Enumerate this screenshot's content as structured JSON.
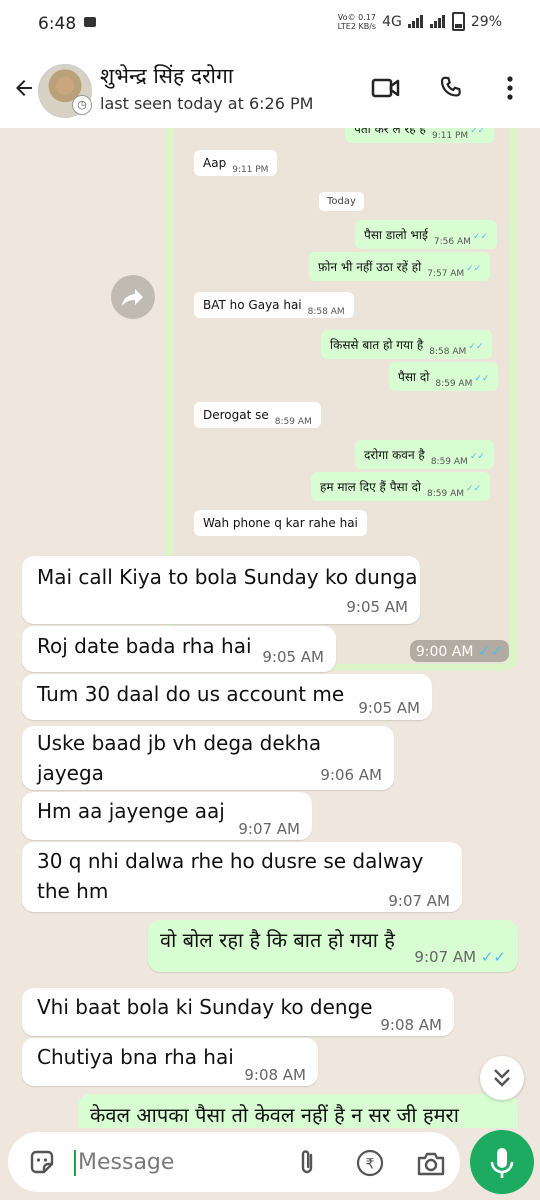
{
  "status_bar": {
    "time": "6:48",
    "network_top": "Vo© 0.17",
    "lte": "LTE2",
    "speed_unit": "KB/s",
    "network": "4G",
    "battery": "29%"
  },
  "header": {
    "contact_name": "शुभेन्द्र सिंह दरोगा",
    "last_seen": "last seen today at 6:26 PM"
  },
  "screenshot": {
    "messages": [
      {
        "dir": "out",
        "text": "पता कर ले रहे हैं",
        "time": "9:11 PM",
        "ticks": "✓✓"
      },
      {
        "dir": "in",
        "text": "Aap",
        "time": "9:11 PM"
      },
      {
        "dir": "out",
        "text": "पैसा डालो भाई",
        "time": "7:56 AM",
        "ticks": "✓✓"
      },
      {
        "dir": "out",
        "text": "फ़ोन भी नहीं उठा रहें हो",
        "time": "7:57 AM",
        "ticks": "✓✓"
      },
      {
        "dir": "in",
        "text": "BAT ho Gaya hai",
        "time": "8:58 AM"
      },
      {
        "dir": "out",
        "text": "किससे बात हो गया है",
        "time": "8:58 AM",
        "ticks": "✓✓"
      },
      {
        "dir": "out",
        "text": "पैसा दो",
        "time": "8:59 AM",
        "ticks": "✓✓"
      },
      {
        "dir": "in",
        "text": "Derogat se",
        "time": "8:59 AM"
      },
      {
        "dir": "out",
        "text": "दरोगा कवन है",
        "time": "8:59 AM",
        "ticks": "✓✓"
      },
      {
        "dir": "out",
        "text": "हम माल दिए हैं पैसा दो",
        "time": "8:59 AM",
        "ticks": "✓✓"
      },
      {
        "dir": "in",
        "text": "Wah phone q kar rahe hai",
        "time": ""
      }
    ],
    "today_label": "Today",
    "time": "9:00 AM",
    "ticks": "✓✓"
  },
  "messages": [
    {
      "dir": "in",
      "text": "Mai call Kiya to bola Sunday ko dunga",
      "time": "9:05 AM"
    },
    {
      "dir": "in",
      "text": "Roj date bada rha hai",
      "time": "9:05 AM"
    },
    {
      "dir": "in",
      "text": "Tum 30 daal do us account me",
      "time": "9:05 AM"
    },
    {
      "dir": "in",
      "text": "Uske baad jb vh dega dekha jayega",
      "time": "9:06 AM"
    },
    {
      "dir": "in",
      "text": "Hm aa jayenge aaj",
      "time": "9:07 AM"
    },
    {
      "dir": "in",
      "text": "30 q nhi dalwa rhe ho dusre se dalway the hm",
      "time": "9:07 AM"
    },
    {
      "dir": "out",
      "text": "वो बोल रहा है कि बात हो गया है",
      "time": "9:07 AM",
      "ticks": "✓✓"
    },
    {
      "dir": "in",
      "text": "Vhi baat bola ki Sunday ko denge",
      "time": "9:08 AM"
    },
    {
      "dir": "in",
      "text": "Chutiya bna rha hai",
      "time": "9:08 AM"
    },
    {
      "dir": "out",
      "text": "केवल आपका पैसा तो केवल नहीं है न सर जी हमरा",
      "time": ""
    }
  ],
  "composer": {
    "placeholder": "Message"
  },
  "icons": {
    "back": "back-arrow-icon",
    "video": "video-call-icon",
    "call": "phone-icon",
    "menu": "more-vert-icon",
    "sticker": "sticker-icon",
    "attach": "paperclip-icon",
    "payment": "rupee-icon",
    "camera": "camera-icon",
    "mic": "mic-icon",
    "scroll": "double-chevron-down-icon",
    "forward": "forward-icon"
  },
  "colors": {
    "accent": "#1daa61",
    "outgoing_bubble": "#d9fdd3",
    "incoming_bubble": "#ffffff",
    "read_ticks": "#53bdeb",
    "chat_background": "#efe7dd"
  }
}
